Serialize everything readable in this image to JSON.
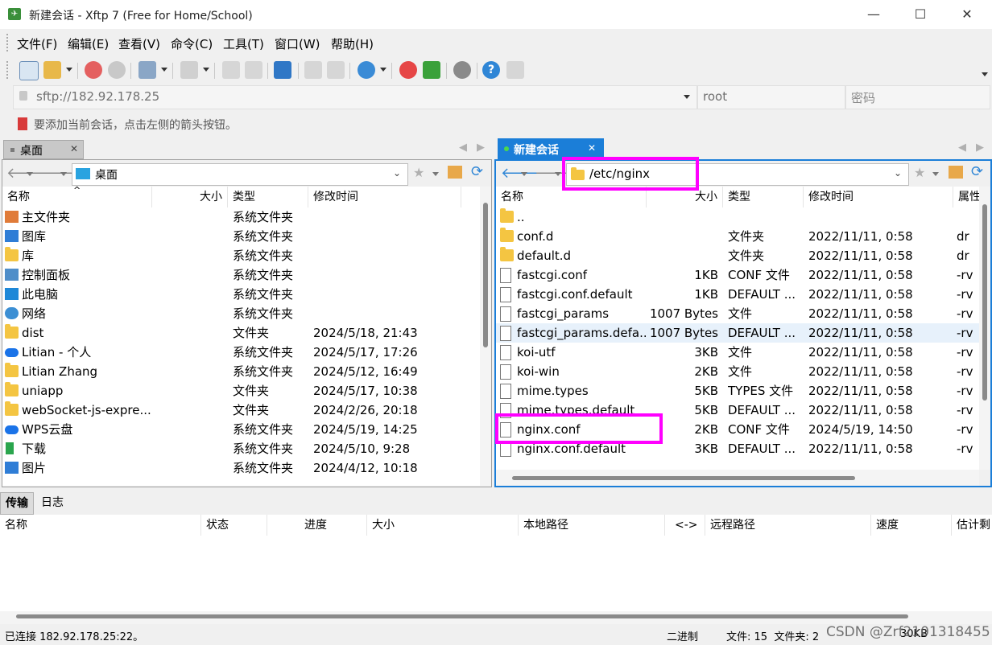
{
  "window": {
    "title": "新建会话 - Xftp 7 (Free for Home/School)",
    "app_icon": "xftp-icon",
    "controls": [
      "minimize-icon",
      "maximize-icon",
      "close-icon"
    ]
  },
  "menu": [
    {
      "label": "文件(F)"
    },
    {
      "label": "编辑(E)"
    },
    {
      "label": "查看(V)"
    },
    {
      "label": "命令(C)"
    },
    {
      "label": "工具(T)"
    },
    {
      "label": "窗口(W)"
    },
    {
      "label": "帮助(H)"
    }
  ],
  "address": {
    "value": "sftp://182.92.178.25",
    "user": "root",
    "password_placeholder": "密码"
  },
  "info": {
    "text": "要添加当前会话，点击左侧的箭头按钮。"
  },
  "left_pane": {
    "tab_label": "桌面",
    "path": "桌面",
    "columns": [
      "名称",
      "大小",
      "类型",
      "修改时间"
    ],
    "rows": [
      {
        "icon": "home-icon",
        "name": "主文件夹",
        "size": "",
        "type": "系统文件夹",
        "modified": ""
      },
      {
        "icon": "gallery-icon",
        "name": "图库",
        "size": "",
        "type": "系统文件夹",
        "modified": ""
      },
      {
        "icon": "folder-icon",
        "name": "库",
        "size": "",
        "type": "系统文件夹",
        "modified": ""
      },
      {
        "icon": "control-panel-icon",
        "name": "控制面板",
        "size": "",
        "type": "系统文件夹",
        "modified": ""
      },
      {
        "icon": "computer-icon",
        "name": "此电脑",
        "size": "",
        "type": "系统文件夹",
        "modified": ""
      },
      {
        "icon": "network-icon",
        "name": "网络",
        "size": "",
        "type": "系统文件夹",
        "modified": ""
      },
      {
        "icon": "folder-icon",
        "name": "dist",
        "size": "",
        "type": "文件夹",
        "modified": "2024/5/18, 21:43"
      },
      {
        "icon": "cloud-icon",
        "name": "Litian - 个人",
        "size": "",
        "type": "系统文件夹",
        "modified": "2024/5/17, 17:26"
      },
      {
        "icon": "folder-icon",
        "name": "Litian Zhang",
        "size": "",
        "type": "系统文件夹",
        "modified": "2024/5/12, 16:49"
      },
      {
        "icon": "folder-icon",
        "name": "uniapp",
        "size": "",
        "type": "文件夹",
        "modified": "2024/5/17, 10:38"
      },
      {
        "icon": "folder-icon",
        "name": "webSocket-js-expre...",
        "size": "",
        "type": "文件夹",
        "modified": "2024/2/26, 20:18"
      },
      {
        "icon": "cloud-icon",
        "name": "WPS云盘",
        "size": "",
        "type": "系统文件夹",
        "modified": "2024/5/19, 14:25"
      },
      {
        "icon": "download-icon",
        "name": "下载",
        "size": "",
        "type": "系统文件夹",
        "modified": "2024/5/10, 9:28"
      },
      {
        "icon": "picture-icon",
        "name": "图片",
        "size": "",
        "type": "系统文件夹",
        "modified": "2024/4/12, 10:18"
      }
    ]
  },
  "right_pane": {
    "tab_label": "新建会话",
    "path": "/etc/nginx",
    "columns": [
      "名称",
      "大小",
      "类型",
      "修改时间",
      "属性"
    ],
    "rows": [
      {
        "icon": "folder-icon",
        "name": "..",
        "size": "",
        "type": "",
        "modified": "",
        "attr": ""
      },
      {
        "icon": "folder-icon",
        "name": "conf.d",
        "size": "",
        "type": "文件夹",
        "modified": "2022/11/11, 0:58",
        "attr": "dr"
      },
      {
        "icon": "folder-icon",
        "name": "default.d",
        "size": "",
        "type": "文件夹",
        "modified": "2022/11/11, 0:58",
        "attr": "dr"
      },
      {
        "icon": "file-icon",
        "name": "fastcgi.conf",
        "size": "1KB",
        "type": "CONF 文件",
        "modified": "2022/11/11, 0:58",
        "attr": "-rv"
      },
      {
        "icon": "file-icon",
        "name": "fastcgi.conf.default",
        "size": "1KB",
        "type": "DEFAULT ...",
        "modified": "2022/11/11, 0:58",
        "attr": "-rv"
      },
      {
        "icon": "file-icon",
        "name": "fastcgi_params",
        "size": "1007 Bytes",
        "type": "文件",
        "modified": "2022/11/11, 0:58",
        "attr": "-rv"
      },
      {
        "icon": "file-icon",
        "name": "fastcgi_params.defa...",
        "size": "1007 Bytes",
        "type": "DEFAULT ...",
        "modified": "2022/11/11, 0:58",
        "attr": "-rv"
      },
      {
        "icon": "file-icon",
        "name": "koi-utf",
        "size": "3KB",
        "type": "文件",
        "modified": "2022/11/11, 0:58",
        "attr": "-rv"
      },
      {
        "icon": "file-icon",
        "name": "koi-win",
        "size": "2KB",
        "type": "文件",
        "modified": "2022/11/11, 0:58",
        "attr": "-rv"
      },
      {
        "icon": "file-icon",
        "name": "mime.types",
        "size": "5KB",
        "type": "TYPES 文件",
        "modified": "2022/11/11, 0:58",
        "attr": "-rv"
      },
      {
        "icon": "file-icon",
        "name": "mime.types.default",
        "size": "5KB",
        "type": "DEFAULT ...",
        "modified": "2022/11/11, 0:58",
        "attr": "-rv"
      },
      {
        "icon": "file-icon",
        "name": "nginx.conf",
        "size": "2KB",
        "type": "CONF 文件",
        "modified": "2024/5/19, 14:50",
        "attr": "-rv"
      },
      {
        "icon": "file-icon",
        "name": "nginx.conf.default",
        "size": "3KB",
        "type": "DEFAULT ...",
        "modified": "2022/11/11, 0:58",
        "attr": "-rv"
      }
    ],
    "highlight_color": "#ff00ff"
  },
  "transfer": {
    "tabs": [
      "传输",
      "日志"
    ],
    "columns": [
      "名称",
      "状态",
      "进度",
      "大小",
      "本地路径",
      "<->",
      "远程路径",
      "速度",
      "估计剩"
    ]
  },
  "status": {
    "left": "已连接 182.92.178.25:22。",
    "mode": "二进制",
    "files": "文件: 15  文件夹: 2",
    "size": "30KB"
  },
  "watermark": "CSDN @Zrf2101318455"
}
